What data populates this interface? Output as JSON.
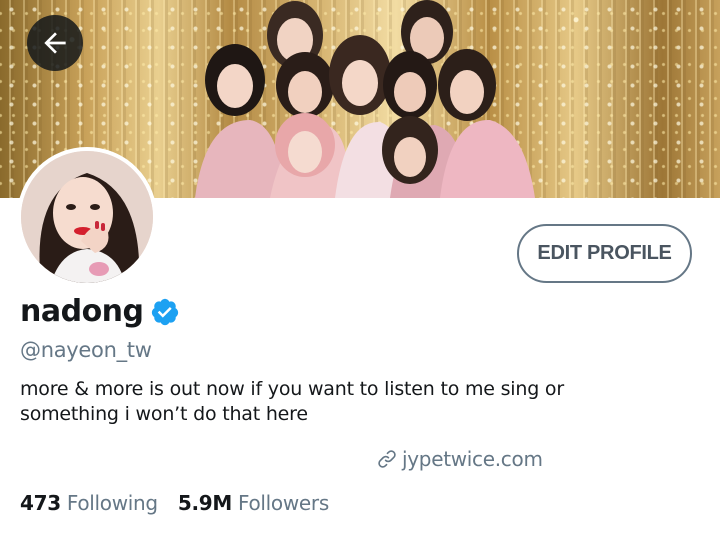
{
  "header": {
    "back_icon": "arrow-left-icon",
    "banner_alt": "group photo banner"
  },
  "profile": {
    "display_name": "nadong",
    "verified_icon": "verified-badge-icon",
    "handle": "@nayeon_tw",
    "bio_line_1": "more & more is out now if you want to listen to me sing or",
    "bio_line_2": "something i won’t do that here",
    "website_icon": "link-icon",
    "website": "jypetwice.com",
    "edit_profile_label": "EDIT PROFILE"
  },
  "stats": {
    "following_count": "473",
    "following_label": "Following",
    "followers_count": "5.9M",
    "followers_label": "Followers"
  },
  "colors": {
    "text_primary": "#14171a",
    "text_secondary": "#657786",
    "verified_blue": "#1da1f2",
    "back_button_bg": "#14171a"
  }
}
